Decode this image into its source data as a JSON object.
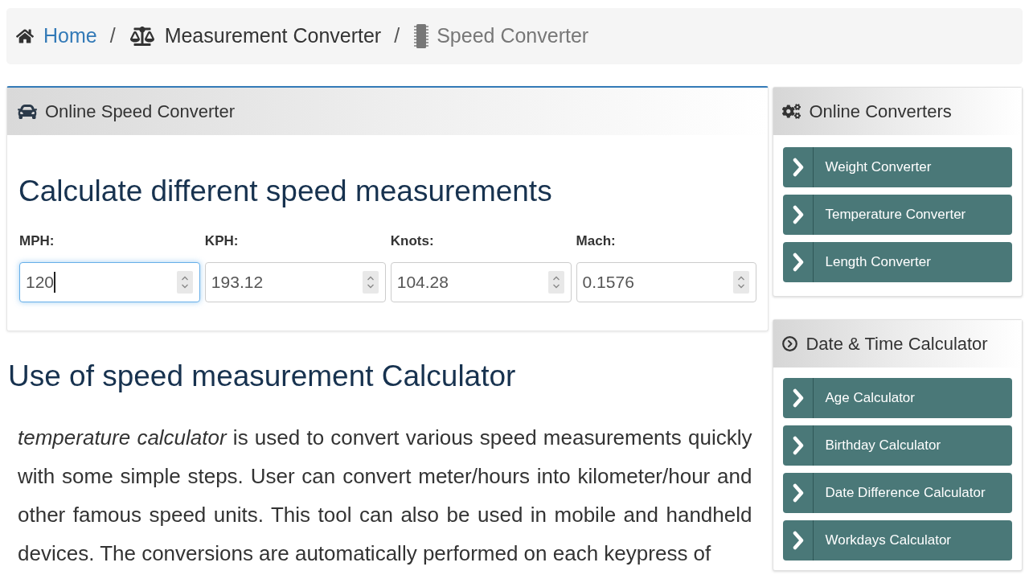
{
  "breadcrumb": [
    {
      "kind": "link",
      "label": "Home"
    },
    {
      "kind": "section",
      "separator": "/",
      "label": "Measurement Converter"
    },
    {
      "kind": "current",
      "separator": "/",
      "label": "Speed Converter"
    }
  ],
  "converter": {
    "title": "Online Speed Converter",
    "heading": "Calculate different speed measurements",
    "fields": [
      {
        "label": "MPH:",
        "value": "120",
        "focused": true
      },
      {
        "label": "KPH:",
        "value": "193.12",
        "focused": false
      },
      {
        "label": "Knots:",
        "value": "104.28",
        "focused": false
      },
      {
        "label": "Mach:",
        "value": "0.1576",
        "focused": false
      }
    ]
  },
  "article": {
    "heading": "Use of speed measurement Calculator",
    "paragraph": "*temperature calculator* is used to convert various speed measurements quickly with some simple steps. User can convert meter/hours into kilometer/hour and other famous speed units. This tool can also be used in mobile and handheld devices. The conversions are automatically performed on each keypress of"
  },
  "sidebar": [
    {
      "title": "Online Converters",
      "links": [
        {
          "label": "Weight Converter"
        },
        {
          "label": "Temperature Converter"
        },
        {
          "label": "Length Converter"
        }
      ]
    },
    {
      "title": "Date & Time Calculator",
      "links": [
        {
          "label": "Age Calculator"
        },
        {
          "label": "Birthday Calculator"
        },
        {
          "label": "Date Difference Calculator"
        },
        {
          "label": "Workdays Calculator"
        }
      ]
    }
  ]
}
